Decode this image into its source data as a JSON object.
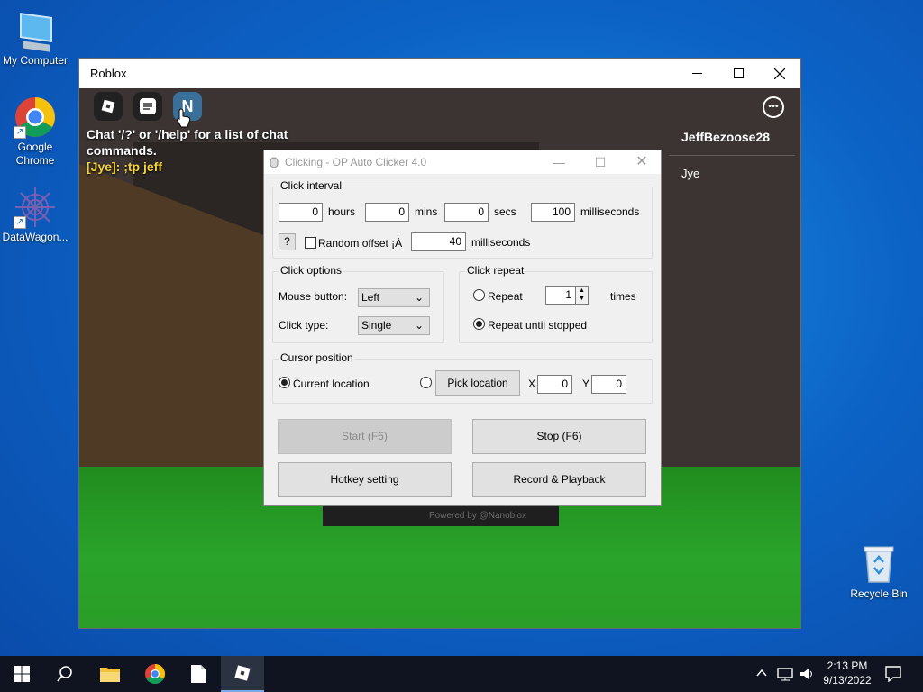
{
  "desktop": {
    "icons": [
      {
        "label": "My Computer"
      },
      {
        "label": "Google Chrome"
      },
      {
        "label": "DataWagon..."
      },
      {
        "label": "Recycle Bin"
      }
    ]
  },
  "roblox_window": {
    "title": "Roblox",
    "chat": {
      "system_message": "Chat '/?' or '/help' for a list of chat commands.",
      "user_line": "[Jye]: ;tp jeff"
    },
    "players": {
      "self": "JeffBezoose28",
      "other": "Jye"
    },
    "top_icon_n": "N",
    "powered_by": "Powered by @Nanoblox"
  },
  "autoclicker": {
    "title": "Clicking - OP Auto Clicker 4.0",
    "click_interval": {
      "label": "Click interval",
      "hours_value": "0",
      "hours_label": "hours",
      "mins_value": "0",
      "mins_label": "mins",
      "secs_value": "0",
      "secs_label": "secs",
      "ms_value": "100",
      "ms_label": "milliseconds",
      "help_label": "?",
      "random_offset_label": "Random offset ¡À",
      "random_offset_value": "40",
      "random_offset_unit": "milliseconds"
    },
    "click_options": {
      "label": "Click options",
      "mouse_button_label": "Mouse button:",
      "mouse_button_value": "Left",
      "click_type_label": "Click type:",
      "click_type_value": "Single"
    },
    "click_repeat": {
      "label": "Click repeat",
      "repeat_label": "Repeat",
      "repeat_value": "1",
      "times_label": "times",
      "until_stopped_label": "Repeat until stopped"
    },
    "cursor_position": {
      "label": "Cursor position",
      "current_label": "Current location",
      "pick_label": "Pick location",
      "x_label": "X",
      "x_value": "0",
      "y_label": "Y",
      "y_value": "0"
    },
    "buttons": {
      "start": "Start (F6)",
      "stop": "Stop (F6)",
      "hotkey": "Hotkey setting",
      "record": "Record & Playback"
    }
  },
  "taskbar": {
    "time": "2:13 PM",
    "date": "9/13/2022"
  }
}
